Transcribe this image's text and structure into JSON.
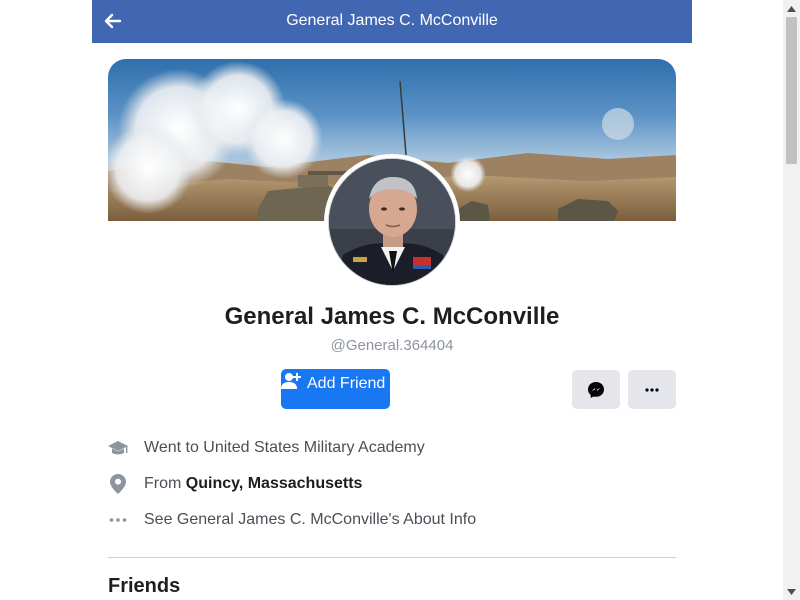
{
  "header": {
    "title": "General James C. McConville",
    "back_icon": "arrow-left-icon",
    "background_color": "#4267b2"
  },
  "profile": {
    "name": "General James C. McConville",
    "handle": "@General.364404",
    "cover_image": "cover-photo",
    "avatar_image": "profile-photo"
  },
  "actions": {
    "add_friend_label": "Add Friend",
    "add_friend_color": "#1877f2",
    "messenger_icon": "messenger-icon",
    "more_icon": "more-dots-icon"
  },
  "about": {
    "education": {
      "icon": "graduation-cap-icon",
      "text": "Went to United States Military Academy"
    },
    "hometown": {
      "icon": "location-pin-icon",
      "prefix": "From ",
      "place": "Quincy, Massachusetts"
    },
    "about_link": {
      "icon": "more-dots-icon",
      "text": "See General James C. McConville's About Info"
    }
  },
  "friends": {
    "heading": "Friends"
  }
}
